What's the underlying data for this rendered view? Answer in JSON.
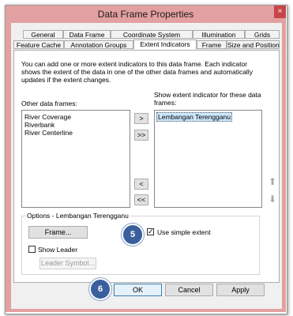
{
  "window": {
    "title": "Data Frame Properties",
    "close_glyph": "×"
  },
  "tabs_row1": [
    "General",
    "Data Frame",
    "Coordinate System",
    "Illumination",
    "Grids"
  ],
  "tabs_row2": [
    "Feature Cache",
    "Annotation Groups",
    "Extent Indicators",
    "Frame",
    "Size and Position"
  ],
  "active_tab": "Extent Indicators",
  "description": [
    "You can add one or more extent indicators to this data frame.  Each indicator",
    "shows the extent of the data in one of the other data frames and automatically",
    "updates if the extent changes."
  ],
  "other_frames": {
    "label": "Other data frames:",
    "items": [
      "River Coverage",
      "Riverbank",
      "River Centerline"
    ]
  },
  "show_extent": {
    "label_line1": "Show extent indicator for these data",
    "label_line2": "frames:",
    "items": [
      "Lembangan Terengganu"
    ]
  },
  "move_buttons": {
    "add_one": ">",
    "add_all": ">>",
    "remove_one": "<",
    "remove_all": "<<"
  },
  "order_buttons": {
    "up": "⬆",
    "down": "⬇"
  },
  "options": {
    "label": "Options - Lembangan Terengganu",
    "frame_button": "Frame...",
    "use_simple_extent": "Use simple extent",
    "use_simple_extent_checked": true,
    "show_leader": "Show Leader",
    "show_leader_checked": false,
    "leader_symbol_button": "Leader Symbol..."
  },
  "footer": {
    "ok": "OK",
    "cancel": "Cancel",
    "apply": "Apply"
  },
  "callouts": [
    "5",
    "6"
  ],
  "icons": {
    "close": "close-icon",
    "up": "arrow-up-icon",
    "down": "arrow-down-icon"
  },
  "colors": {
    "titlebar": "#e3a0a0",
    "selection": "#cce8ff",
    "callout": "#3a5f9d"
  }
}
